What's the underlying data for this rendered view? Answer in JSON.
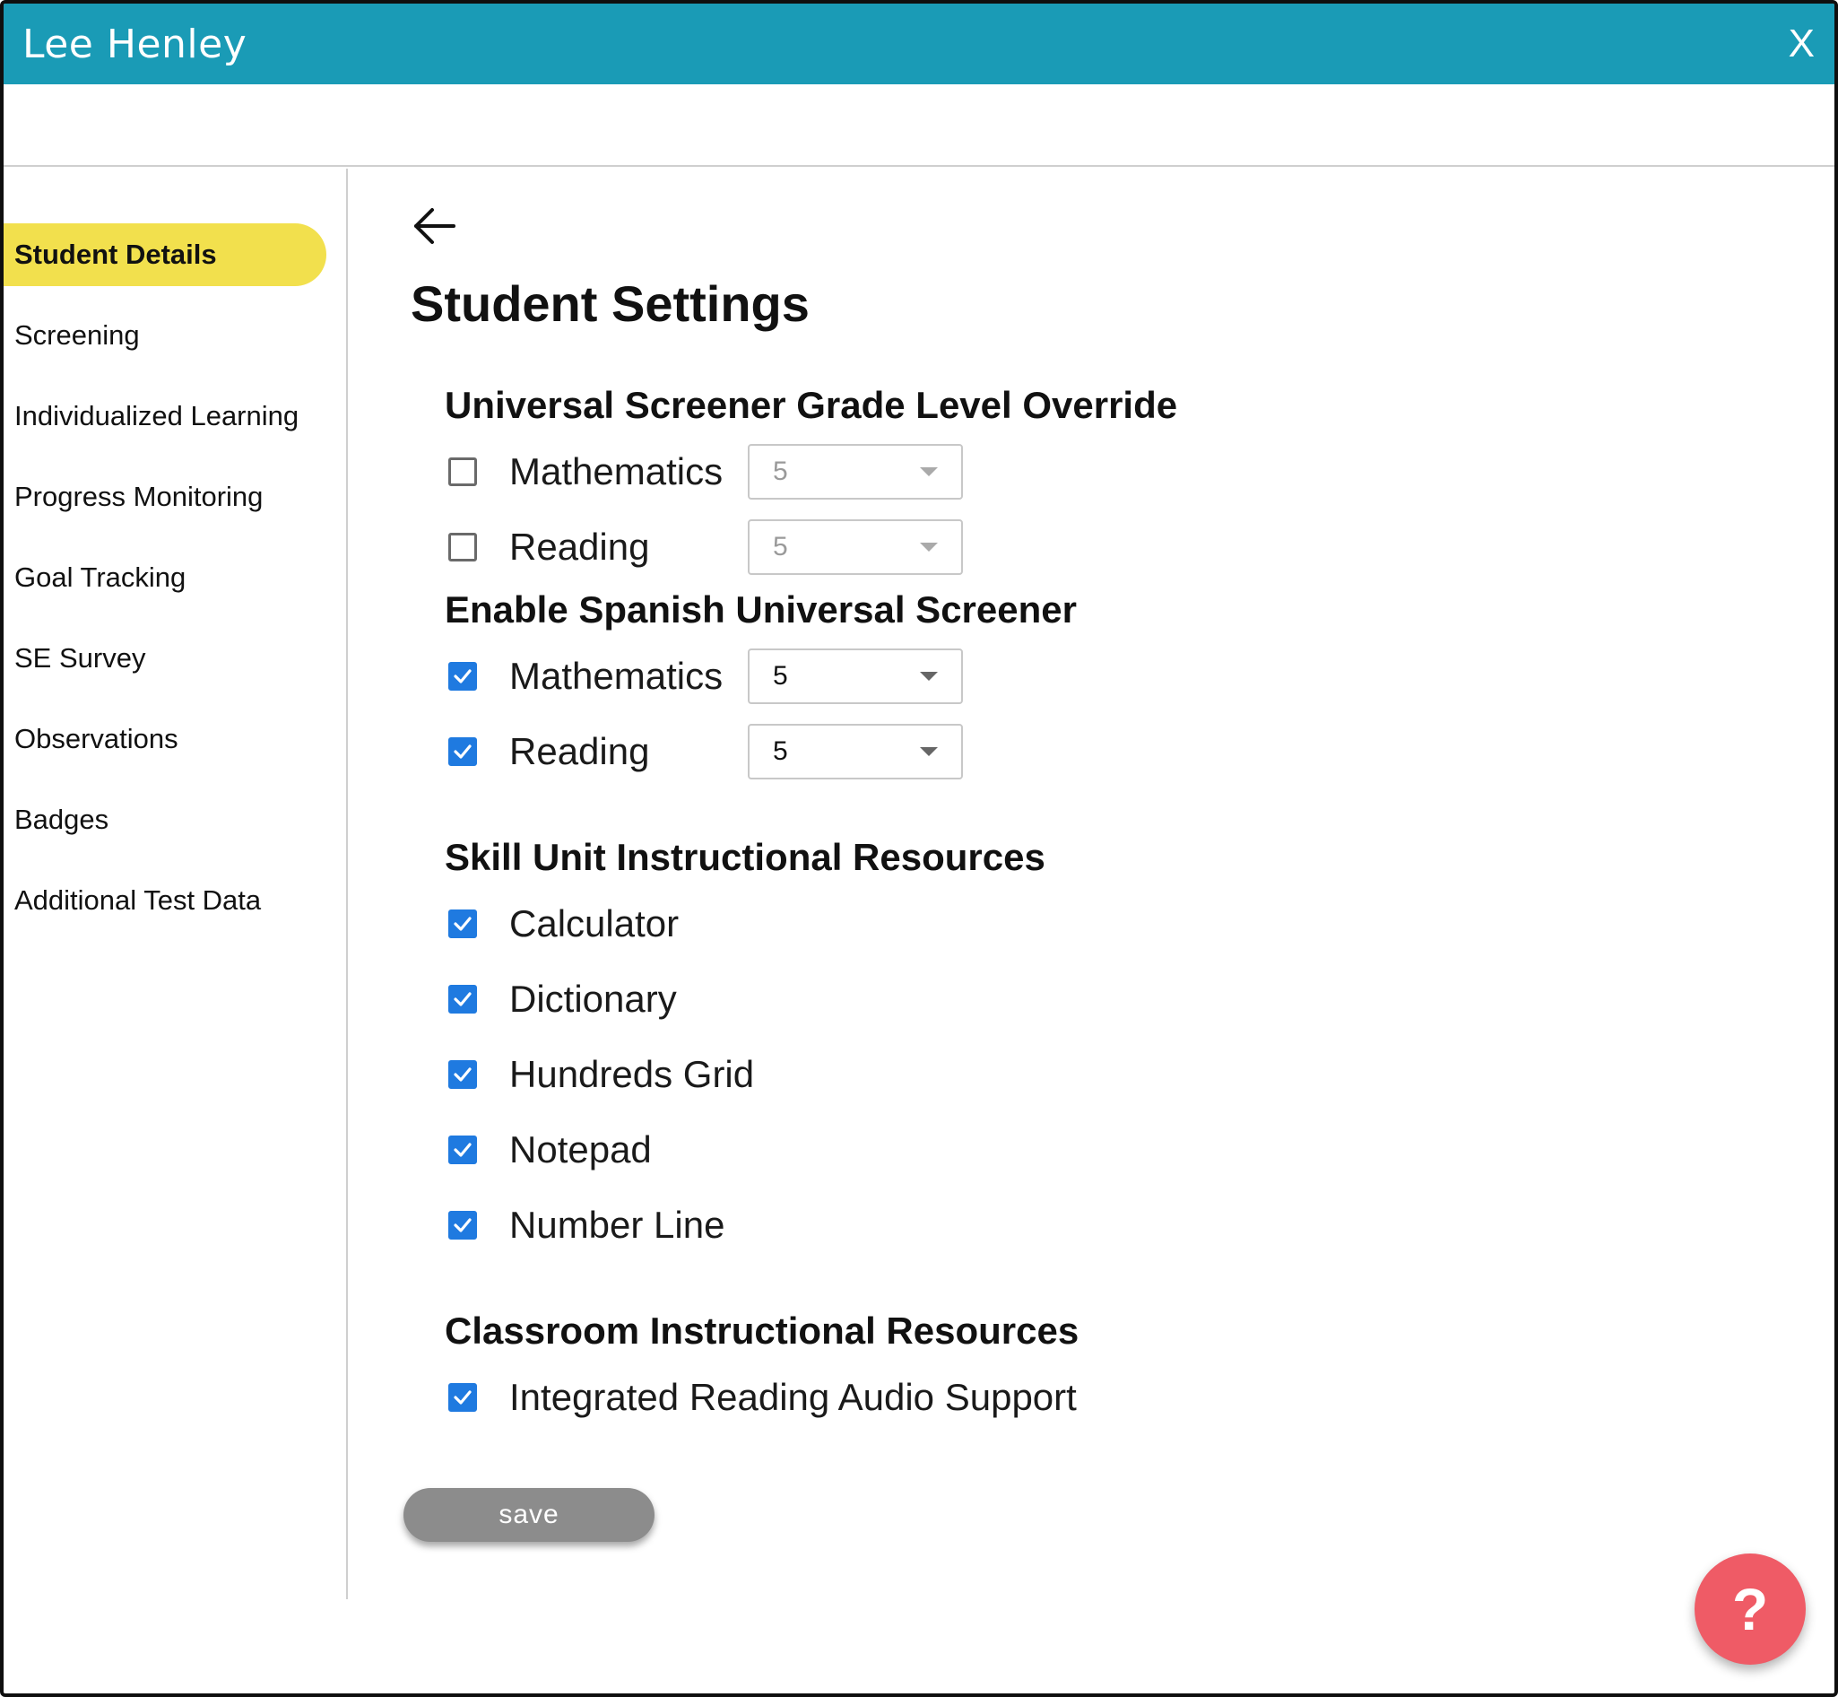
{
  "window": {
    "title": "Lee Henley",
    "close_label": "X"
  },
  "sidebar": {
    "items": [
      {
        "label": "Student Details",
        "active": true
      },
      {
        "label": "Screening",
        "active": false
      },
      {
        "label": "Individualized Learning",
        "active": false
      },
      {
        "label": "Progress Monitoring",
        "active": false
      },
      {
        "label": "Goal Tracking",
        "active": false
      },
      {
        "label": "SE Survey",
        "active": false
      },
      {
        "label": "Observations",
        "active": false
      },
      {
        "label": "Badges",
        "active": false
      },
      {
        "label": "Additional Test Data",
        "active": false
      }
    ]
  },
  "main": {
    "back_icon": "arrow-left-icon",
    "page_title": "Student Settings",
    "override": {
      "title": "Universal Screener Grade Level Override",
      "math_label": "Mathematics",
      "math_checked": false,
      "math_grade": "5",
      "reading_label": "Reading",
      "reading_checked": false,
      "reading_grade": "5"
    },
    "spanish": {
      "title": "Enable Spanish Universal Screener",
      "math_label": "Mathematics",
      "math_checked": true,
      "math_grade": "5",
      "reading_label": "Reading",
      "reading_checked": true,
      "reading_grade": "5"
    },
    "skill_unit": {
      "title": "Skill Unit Instructional Resources",
      "items": [
        {
          "label": "Calculator",
          "checked": true
        },
        {
          "label": "Dictionary",
          "checked": true
        },
        {
          "label": "Hundreds Grid",
          "checked": true
        },
        {
          "label": "Notepad",
          "checked": true
        },
        {
          "label": "Number Line",
          "checked": true
        }
      ]
    },
    "classroom": {
      "title": "Classroom Instructional Resources",
      "items": [
        {
          "label": "Integrated Reading Audio Support",
          "checked": true
        }
      ]
    },
    "save_label": "save"
  },
  "help": {
    "label": "?",
    "icon": "question-mark-icon"
  },
  "colors": {
    "header": "#1a9bb6",
    "active_nav": "#f2e04d",
    "checkbox": "#1f7ae0",
    "save_button": "#8c8c8c",
    "help_button": "#ef5b66"
  }
}
